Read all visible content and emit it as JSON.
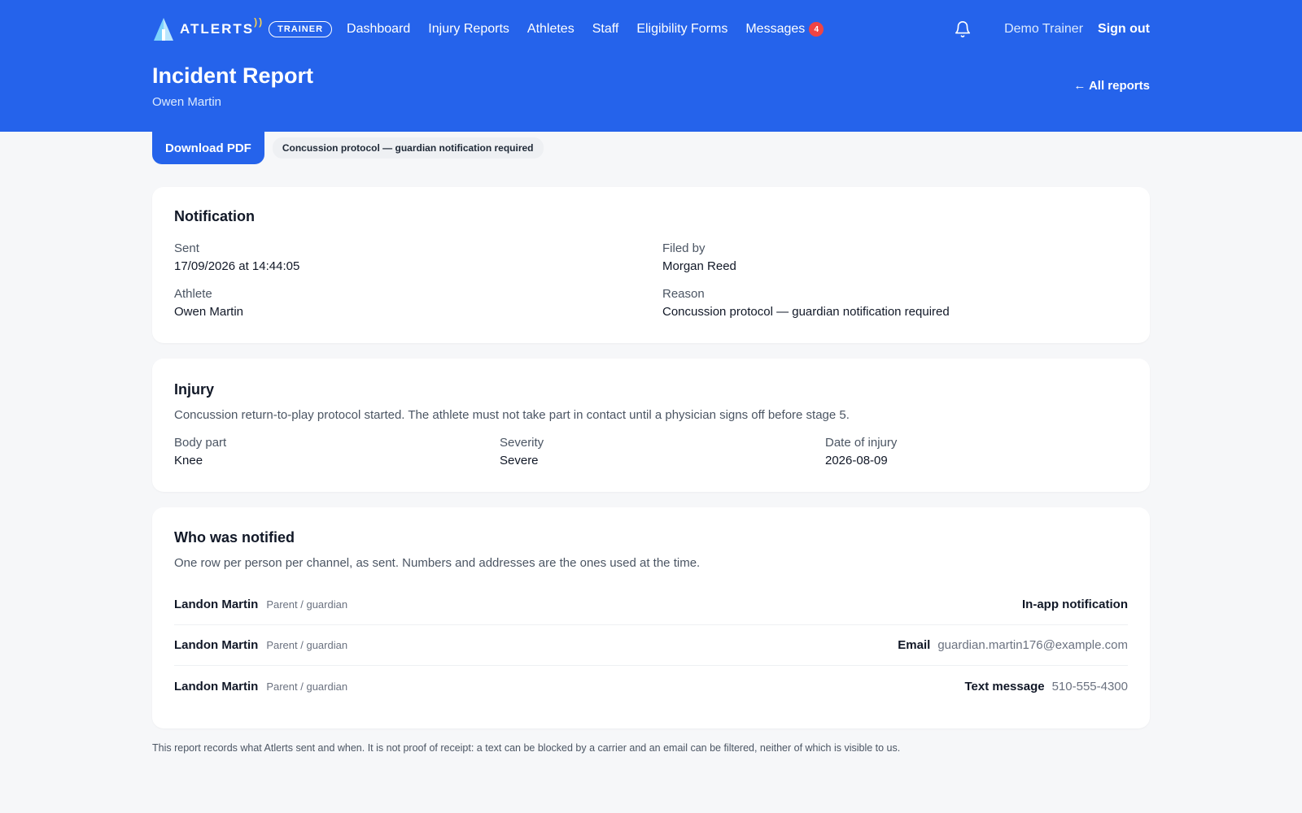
{
  "nav": {
    "brand": "ATLERTS",
    "role": "TRAINER",
    "links": [
      {
        "label": "Dashboard"
      },
      {
        "label": "Injury Reports"
      },
      {
        "label": "Athletes"
      },
      {
        "label": "Staff"
      },
      {
        "label": "Eligibility Forms"
      },
      {
        "label": "Messages",
        "badge": "4"
      }
    ],
    "user": "Demo Trainer",
    "signout": "Sign out"
  },
  "header": {
    "title": "Incident Report",
    "subtitle": "Owen Martin",
    "back_link": "← All reports"
  },
  "actions": {
    "download": "Download PDF",
    "reason_chip": "Concussion protocol — guardian notification required"
  },
  "notification": {
    "title": "Notification",
    "sent_label": "Sent",
    "sent_value": "17/09/2026 at 14:44:05",
    "filed_label": "Filed by",
    "filed_value": "Morgan Reed",
    "athlete_label": "Athlete",
    "athlete_value": "Owen Martin",
    "reason_label": "Reason",
    "reason_value": "Concussion protocol — guardian notification required"
  },
  "injury": {
    "title": "Injury",
    "description": "Concussion return-to-play protocol started. The athlete must not take part in contact until a physician signs off before stage 5.",
    "body_label": "Body part",
    "body_value": "Knee",
    "severity_label": "Severity",
    "severity_value": "Severe",
    "date_label": "Date of injury",
    "date_value": "2026-08-09"
  },
  "notified": {
    "title": "Who was notified",
    "description": "One row per person per channel, as sent. Numbers and addresses are the ones used at the time.",
    "rows": [
      {
        "name": "Landon Martin",
        "relation": "Parent / guardian",
        "channel": "In-app notification",
        "contact": ""
      },
      {
        "name": "Landon Martin",
        "relation": "Parent / guardian",
        "channel": "Email",
        "contact": "guardian.martin176@example.com"
      },
      {
        "name": "Landon Martin",
        "relation": "Parent / guardian",
        "channel": "Text message",
        "contact": "510-555-4300"
      }
    ]
  },
  "footer": {
    "note": "This report records what Atlerts sent and when. It is not proof of receipt: a text can be blocked by a carrier and an email can be filtered, neither of which is visible to us."
  },
  "colors": {
    "brand_blue": "#2563eb",
    "badge_red": "#ef4444"
  }
}
